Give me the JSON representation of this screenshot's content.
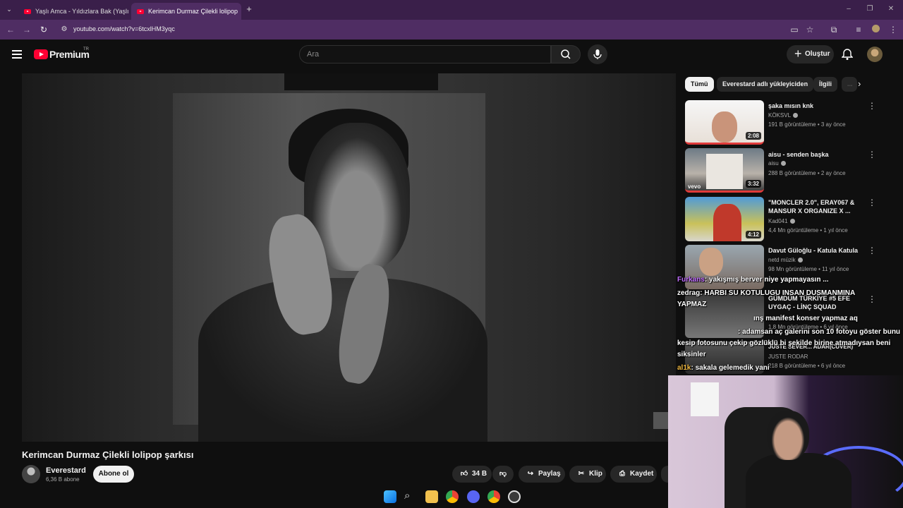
{
  "browser": {
    "tabs": [
      {
        "title": "Yaşlı Amca - Yıldızlara Bak (Yaşlı",
        "active": false
      },
      {
        "title": "Kerimcan Durmaz Çilekli lolipop",
        "active": true
      }
    ],
    "url": "youtube.com/watch?v=6tcxlHM3yqc"
  },
  "header": {
    "logo_text": "Premium",
    "region": "TR",
    "search_placeholder": "Ara",
    "create_label": "Oluştur"
  },
  "video": {
    "title": "Kerimcan Durmaz Çilekli lolipop şarkısı",
    "channel": "Everestard",
    "subscribers": "6,36 B abone",
    "subscribe_label": "Abone ol",
    "likes": "34 B",
    "share_label": "Paylaş",
    "clip_label": "Klip",
    "save_label": "Kaydet"
  },
  "sidebar": {
    "chips": [
      "Tümü",
      "Everestard adlı yükleyiciden",
      "İlgili",
      "..."
    ],
    "items": [
      {
        "title": "şaka mısın knk",
        "channel": "KÖKSVL",
        "meta": "191 B görüntüleme • 3 ay önce",
        "duration": "2:08"
      },
      {
        "title": "aisu - senden başka",
        "channel": "aisu",
        "meta": "288 B görüntüleme • 2 ay önce",
        "duration": "3:32"
      },
      {
        "title": "\"MONCLER 2.0\", ERAY067 & MANSUR X ORGANIZE X ...",
        "channel": "Kad041",
        "meta": "4,4 Mn görüntüleme • 1 yıl önce",
        "duration": "4:12"
      },
      {
        "title": "Davut Güloğlu - Katula Katula",
        "channel": "netd müzik",
        "meta": "98 Mn görüntüleme • 11 yıl önce",
        "duration": ""
      },
      {
        "title": "GÜMDÜM TÜRKİYE #5 EFE UYGAÇ - LİNÇ SQUAD",
        "channel": "",
        "meta": "1,8 Mn görüntüleme • 6 yıl önce",
        "duration": ""
      },
      {
        "title": "JUSTE SEVER... ADAR(CUVER)",
        "channel": "JUSTE RODAR",
        "meta": "218 B görüntüleme • 6 yıl önce",
        "duration": ""
      }
    ]
  },
  "chat": [
    {
      "user": "Furkans",
      "text": ": yakışmış berver niye yapmayasın ..."
    },
    {
      "user": "zedrag",
      "text": ": HARBI SU KOTULUGU INSAN DUSMANMINA"
    },
    {
      "user": "",
      "text": "YAPMAZ"
    },
    {
      "user": "",
      "text": "ınş manifest konser yapmaz aq"
    },
    {
      "user": "",
      "text": ": adamsan aç galerini son 10 fotoyu göster bunu"
    },
    {
      "user": "",
      "text": "kesip fotosunu çekip gözlüklü bi şekilde birine atmadıysan beni"
    },
    {
      "user": "",
      "text": "siksinler"
    },
    {
      "user": "al1k",
      "text": ": sakala gelemedik yani"
    }
  ]
}
